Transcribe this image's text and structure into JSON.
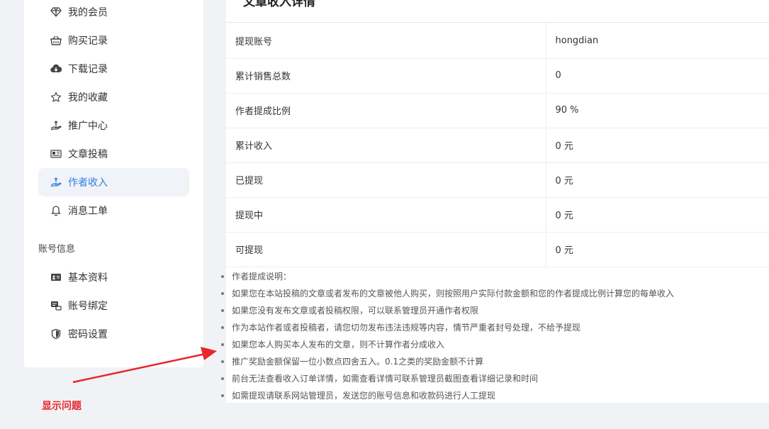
{
  "sidebar": {
    "items": [
      {
        "label": "我的会员",
        "icon": "diamond-icon"
      },
      {
        "label": "购买记录",
        "icon": "basket-icon"
      },
      {
        "label": "下载记录",
        "icon": "cloud-download-icon"
      },
      {
        "label": "我的收藏",
        "icon": "star-icon"
      },
      {
        "label": "推广中心",
        "icon": "hand-coin-icon"
      },
      {
        "label": "文章投稿",
        "icon": "newspaper-icon"
      },
      {
        "label": "作者收入",
        "icon": "hand-coin-icon",
        "active": true
      },
      {
        "label": "消息工单",
        "icon": "bell-icon"
      }
    ],
    "account_section_label": "账号信息",
    "account_items": [
      {
        "label": "基本资料",
        "icon": "id-card-icon"
      },
      {
        "label": "账号绑定",
        "icon": "link-card-icon"
      },
      {
        "label": "密码设置",
        "icon": "shield-icon"
      }
    ]
  },
  "main": {
    "title": "文章收入详情",
    "rows": [
      {
        "key": "提现账号",
        "value": "hongdian"
      },
      {
        "key": "累计销售总数",
        "value": "0"
      },
      {
        "key": "作者提成比例",
        "value": "90 %"
      },
      {
        "key": "累计收入",
        "value": "0 元"
      },
      {
        "key": "已提现",
        "value": "0 元"
      },
      {
        "key": "提现中",
        "value": "0 元"
      },
      {
        "key": "可提现",
        "value": "0 元"
      }
    ],
    "notes": [
      "作者提成说明：",
      "如果您在本站投稿的文章或者发布的文章被他人购买，则按照用户实际付款金额和您的作者提成比例计算您的每单收入",
      "如果您没有发布文章或者投稿权限，可以联系管理员开通作者权限",
      "作为本站作者或者投稿者，请您切勿发布违法违规等内容，情节严重者封号处理，不给予提现",
      "如果您本人购买本人发布的文章，则不计算作者分成收入",
      "推广奖励金额保留一位小数点四舍五入。0.1之类的奖励金额不计算",
      "前台无法查看收入订单详情，如需查看详情可联系管理员截图查看详细记录和时间",
      "如需提现请联系网站管理员，发送您的账号信息和收款码进行人工提现"
    ]
  },
  "annotation": {
    "text": "显示问题",
    "color": "#e8262c"
  },
  "colors": {
    "accent": "#2f7fe0",
    "active_bg": "#f0f3f7",
    "page_bg": "#f0f2f5"
  }
}
